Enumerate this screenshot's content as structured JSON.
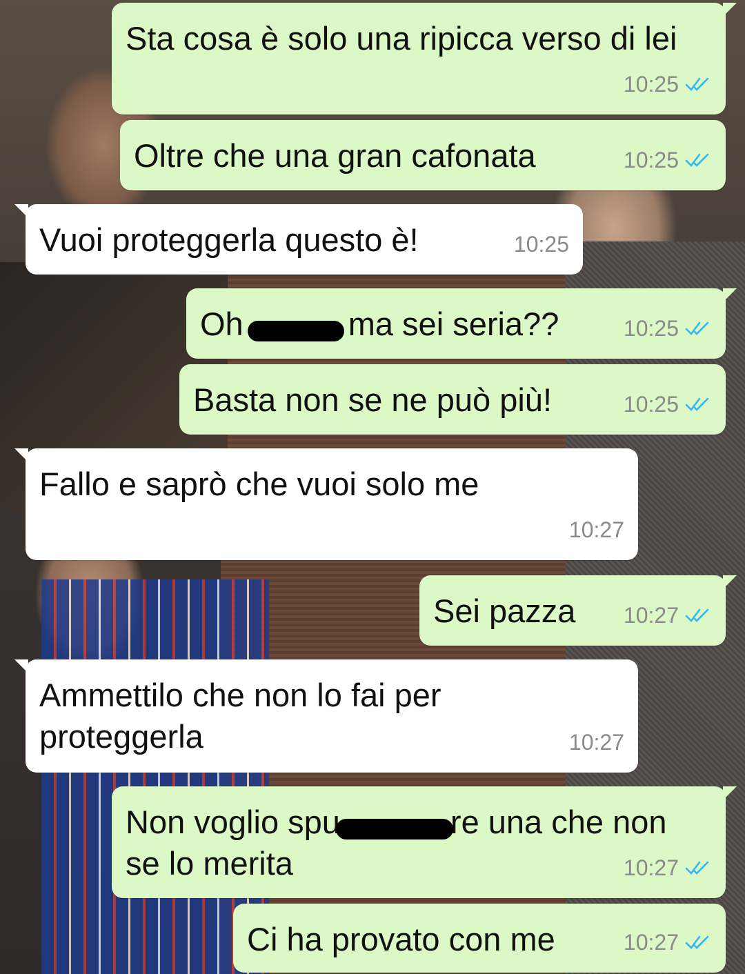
{
  "chat": {
    "messages": [
      {
        "side": "out",
        "text": "Sta cosa è solo una ripicca verso di lei",
        "time": "10:25",
        "status": "read"
      },
      {
        "side": "out",
        "text": "Oltre che una gran cafonata",
        "time": "10:25",
        "status": "read"
      },
      {
        "side": "in",
        "text": "Vuoi proteggerla questo è!",
        "time": "10:25"
      },
      {
        "side": "out",
        "text_before": "Oh",
        "text_after": "ma sei seria??",
        "time": "10:25",
        "status": "read",
        "redacted": true
      },
      {
        "side": "out",
        "text": "Basta non se ne può più!",
        "time": "10:25",
        "status": "read"
      },
      {
        "side": "in",
        "text": "Fallo e saprò che vuoi solo me",
        "time": "10:27"
      },
      {
        "side": "out",
        "text": "Sei pazza",
        "time": "10:27",
        "status": "read"
      },
      {
        "side": "in",
        "text": "Ammettilo che non lo fai per proteggerla",
        "time": "10:27"
      },
      {
        "side": "out",
        "text_before": "Non voglio spu",
        "text_after": "re una che non se lo merita",
        "time": "10:27",
        "status": "read",
        "redacted": true
      },
      {
        "side": "out",
        "text": "Ci ha provato con me",
        "time": "10:27",
        "status": "read"
      }
    ]
  },
  "colors": {
    "outgoing_bubble": "#dcf8c6",
    "incoming_bubble": "#ffffff",
    "read_ticks": "#34b7f1",
    "timestamp": "#8a8a8a"
  },
  "icons": {
    "read_status": "double-check-icon",
    "redaction": "redaction-mark"
  }
}
